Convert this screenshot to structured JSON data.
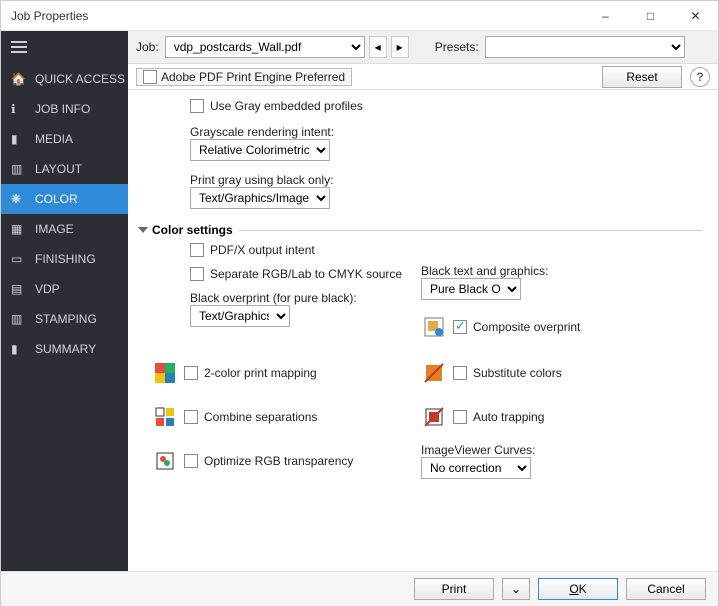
{
  "window": {
    "title": "Job Properties"
  },
  "sidebar": {
    "items": [
      {
        "label": "QUICK ACCESS"
      },
      {
        "label": "JOB INFO"
      },
      {
        "label": "MEDIA"
      },
      {
        "label": "LAYOUT"
      },
      {
        "label": "COLOR"
      },
      {
        "label": "IMAGE"
      },
      {
        "label": "FINISHING"
      },
      {
        "label": "VDP"
      },
      {
        "label": "STAMPING"
      },
      {
        "label": "SUMMARY"
      }
    ]
  },
  "jobbar": {
    "job_label": "Job:",
    "job_value": "vdp_postcards_Wall.pdf",
    "presets_label": "Presets:",
    "presets_value": ""
  },
  "topstrip": {
    "checkbox_label": "Adobe PDF Print Engine Preferred",
    "reset": "Reset"
  },
  "content": {
    "use_gray_profiles": "Use Gray embedded profiles",
    "grayscale_label": "Grayscale rendering intent:",
    "grayscale_value": "Relative Colorimetric",
    "print_gray_label": "Print gray using black only:",
    "print_gray_value": "Text/Graphics/Images",
    "color_settings": "Color settings",
    "pdfx": "PDF/X output intent",
    "separate_rgb": "Separate RGB/Lab to CMYK source",
    "black_text_label": "Black text and graphics:",
    "black_text_value": "Pure Black On",
    "black_overprint_label": "Black overprint (for pure black):",
    "black_overprint_value": "Text/Graphics",
    "composite": "Composite overprint",
    "two_color": "2-color print mapping",
    "substitute": "Substitute colors",
    "combine": "Combine separations",
    "auto_trap": "Auto trapping",
    "optimize_rgb": "Optimize RGB transparency",
    "imageviewer_label": "ImageViewer Curves:",
    "imageviewer_value": "No correction"
  },
  "footer": {
    "print": "Print",
    "ok": "OK",
    "cancel": "Cancel"
  }
}
